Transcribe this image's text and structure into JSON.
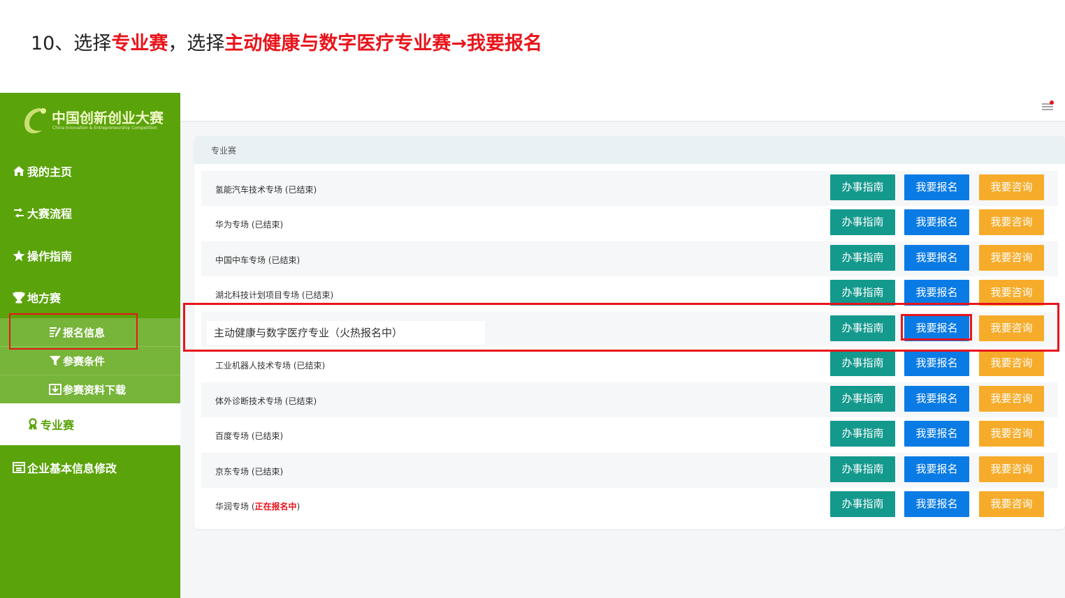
{
  "instruction": {
    "prefix": "10、选择",
    "hl1": "专业赛",
    "mid": "，选择",
    "hl2": "主动健康与数字医疗专业赛→我要报名"
  },
  "logo": {
    "title": "中国创新创业大赛",
    "subtitle": "China Innovation & Entrepreneurship Competition"
  },
  "sidebar": {
    "items": [
      {
        "label": "我的主页",
        "icon": "home-icon"
      },
      {
        "label": "大赛流程",
        "icon": "flow-icon"
      },
      {
        "label": "操作指南",
        "icon": "star-icon"
      },
      {
        "label": "地方赛",
        "icon": "trophy-icon"
      }
    ],
    "sub_items": [
      {
        "label": "报名信息",
        "icon": "edit-list-icon"
      },
      {
        "label": "参赛条件",
        "icon": "filter-icon"
      },
      {
        "label": "参赛资料下载",
        "icon": "download-icon"
      }
    ],
    "active_label": "专业赛",
    "bottom_label": "企业基本信息修改"
  },
  "panel": {
    "title": "专业赛",
    "rows": [
      {
        "name": "氢能汽车技术专场",
        "status": " (已结束)"
      },
      {
        "name": "华为专场",
        "status": " (已结束)"
      },
      {
        "name": "中国中车专场",
        "status": " (已结束)"
      },
      {
        "name": "湖北科技计划项目专场",
        "status": " (已结束)"
      },
      {
        "name": "主动健康与数字医疗专业",
        "status": "（火热报名中）"
      },
      {
        "name": "工业机器人技术专场",
        "status": " (已结束)"
      },
      {
        "name": "体外诊断技术专场",
        "status": " (已结束)"
      },
      {
        "name": "百度专场",
        "status": " (已结束)"
      },
      {
        "name": "京东专场",
        "status": " (已结束)"
      },
      {
        "name": "华润专场",
        "status_open": " (",
        "status_red": "正在报名中",
        "status_close": ")"
      }
    ],
    "buttons": {
      "guide": "办事指南",
      "apply": "我要报名",
      "consult": "我要咨询"
    }
  },
  "colors": {
    "sidebar": "#5aa30a",
    "guide": "#14998d",
    "apply": "#0a7be4",
    "consult": "#f6ac2a",
    "highlight": "#e8141b"
  }
}
